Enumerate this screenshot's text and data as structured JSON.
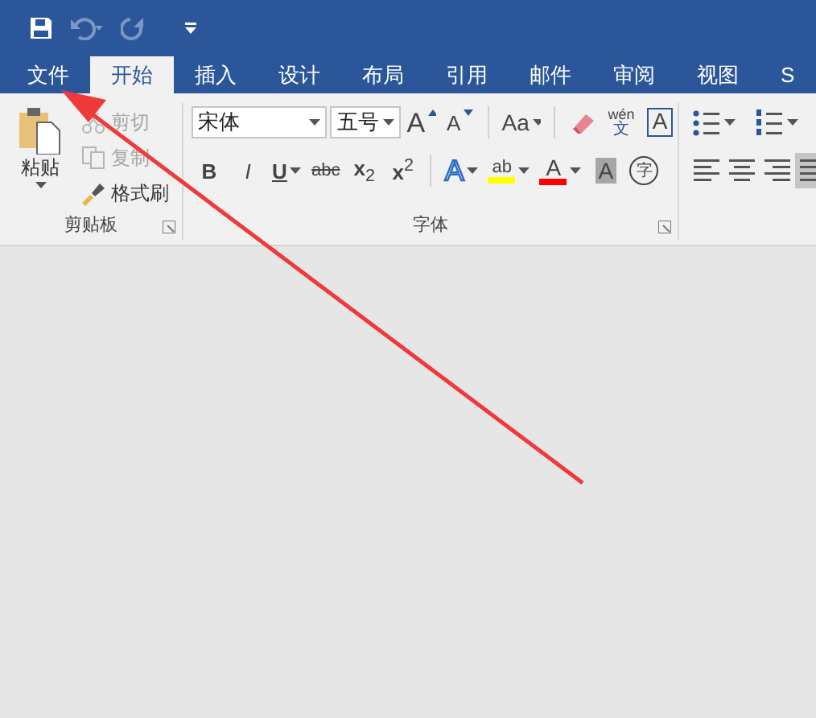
{
  "quick_access": [
    {
      "kind": "save",
      "disabled": false
    },
    {
      "kind": "undo",
      "disabled": true
    },
    {
      "kind": "redo",
      "disabled": true
    },
    {
      "kind": "customize",
      "disabled": false
    }
  ],
  "tabs": [
    {
      "label": "文件",
      "selected": false
    },
    {
      "label": "开始",
      "selected": true
    },
    {
      "label": "插入",
      "selected": false
    },
    {
      "label": "设计",
      "selected": false
    },
    {
      "label": "布局",
      "selected": false
    },
    {
      "label": "引用",
      "selected": false
    },
    {
      "label": "邮件",
      "selected": false
    },
    {
      "label": "审阅",
      "selected": false
    },
    {
      "label": "视图",
      "selected": false
    },
    {
      "label": "S",
      "selected": false
    }
  ],
  "clipboard": {
    "label": "剪贴板",
    "paste": "粘贴",
    "items": [
      {
        "kind": "cut",
        "label": "剪切",
        "disabled": true
      },
      {
        "kind": "copy",
        "label": "复制",
        "disabled": true
      },
      {
        "kind": "painter",
        "label": "格式刷",
        "disabled": false
      }
    ]
  },
  "font": {
    "label": "字体",
    "font_name": "宋体",
    "font_size": "五号",
    "row1": [
      {
        "kind": "grow",
        "label": "A"
      },
      {
        "kind": "shrink",
        "label": "A"
      },
      {
        "kind": "sep"
      },
      {
        "kind": "case",
        "label": "Aa"
      },
      {
        "kind": "sep"
      },
      {
        "kind": "clear"
      },
      {
        "kind": "phonetic",
        "label": "wén",
        "sub": "文"
      },
      {
        "kind": "border",
        "label": "A"
      }
    ],
    "row2": [
      {
        "kind": "bold",
        "label": "B"
      },
      {
        "kind": "italic",
        "label": "I"
      },
      {
        "kind": "underline",
        "label": "U"
      },
      {
        "kind": "strike",
        "label": "abc"
      },
      {
        "kind": "sub",
        "label": "x",
        "sub": "2"
      },
      {
        "kind": "sup",
        "label": "x",
        "sup": "2"
      },
      {
        "kind": "sep"
      },
      {
        "kind": "effects",
        "label": "A"
      },
      {
        "kind": "highlight",
        "label": "ab",
        "color": "#ffff00"
      },
      {
        "kind": "fontcolor",
        "label": "A",
        "color": "#ff0000"
      },
      {
        "kind": "shading",
        "label": "A"
      },
      {
        "kind": "enclose",
        "label": "字"
      }
    ]
  },
  "paragraph": {
    "lists": [
      {
        "kind": "bullets"
      },
      {
        "kind": "numbering"
      }
    ],
    "align": [
      {
        "kind": "left",
        "selected": false
      },
      {
        "kind": "center",
        "selected": false
      },
      {
        "kind": "right",
        "selected": false
      },
      {
        "kind": "justify",
        "selected": true
      }
    ]
  }
}
